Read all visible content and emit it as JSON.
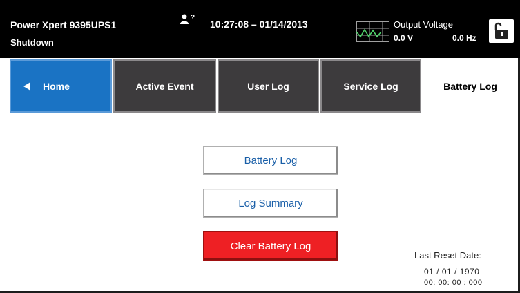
{
  "header": {
    "device_name": "Power Xpert 9395UPS1",
    "device_state": "Shutdown",
    "user_level": "?",
    "datetime": "10:27:08 – 01/14/2013",
    "output_voltage_label": "Output Voltage",
    "output_voltage_value": "0.0 V",
    "output_frequency_value": "0.0 Hz",
    "icons": {
      "user": "user-access-icon",
      "scope": "waveform-meter-icon",
      "lock": "unlocked-padlock-icon"
    }
  },
  "tabs": [
    {
      "label": "Home",
      "icon": "back-triangle-icon",
      "active": false
    },
    {
      "label": "Active Event",
      "active": false
    },
    {
      "label": "User Log",
      "active": false
    },
    {
      "label": "Service Log",
      "active": false
    },
    {
      "label": "Battery Log",
      "active": true
    }
  ],
  "actions": {
    "battery_log": "Battery Log",
    "log_summary": "Log Summary",
    "clear_battery_log": "Clear Battery Log"
  },
  "reset": {
    "label": "Last Reset Date:",
    "date": "01 / 01 / 1970",
    "time": "00: 00: 00 : 000"
  },
  "colors": {
    "header_bg": "#000000",
    "tab_dark": "#3d3b3d",
    "tab_home": "#1a73c4",
    "action_text": "#1a5fa8",
    "danger": "#ee2024"
  }
}
